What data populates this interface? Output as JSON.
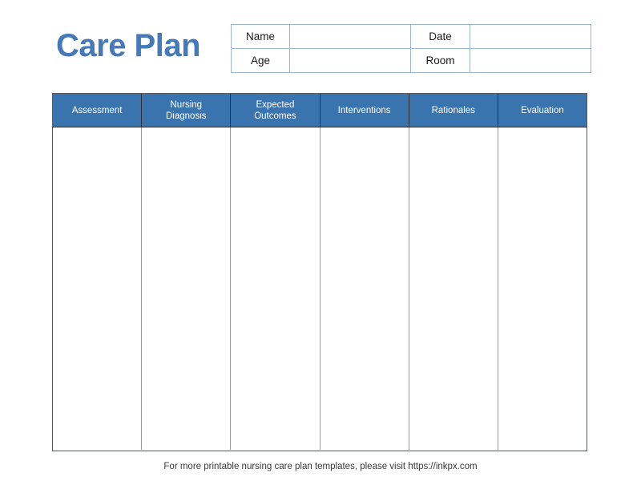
{
  "document": {
    "title": "Care Plan",
    "title_color": "#4579b8",
    "background_color": "#ffffff"
  },
  "info_table": {
    "border_color": "#9bb3d4",
    "rows": [
      {
        "label_left": "Name",
        "value_left": "",
        "label_right": "Date",
        "value_right": ""
      },
      {
        "label_left": "Age",
        "value_left": "",
        "label_right": "Room",
        "value_right": ""
      }
    ]
  },
  "plan_table": {
    "header_background": "#3a74af",
    "header_text_color": "#ffffff",
    "border_color": "#555a5e",
    "divider_color": "#9a9a9a",
    "columns": [
      {
        "line1": "Assessment",
        "line2": ""
      },
      {
        "line1": "Nursing",
        "line2": "Diagnosis"
      },
      {
        "line1": "Expected",
        "line2": "Outcomes"
      },
      {
        "line1": "Interventions",
        "line2": ""
      },
      {
        "line1": "Rationales",
        "line2": ""
      },
      {
        "line1": "Evaluation",
        "line2": ""
      }
    ],
    "body_rows": 0
  },
  "footer": {
    "note": "For more printable nursing care plan templates, please visit https://inkpx.com"
  }
}
